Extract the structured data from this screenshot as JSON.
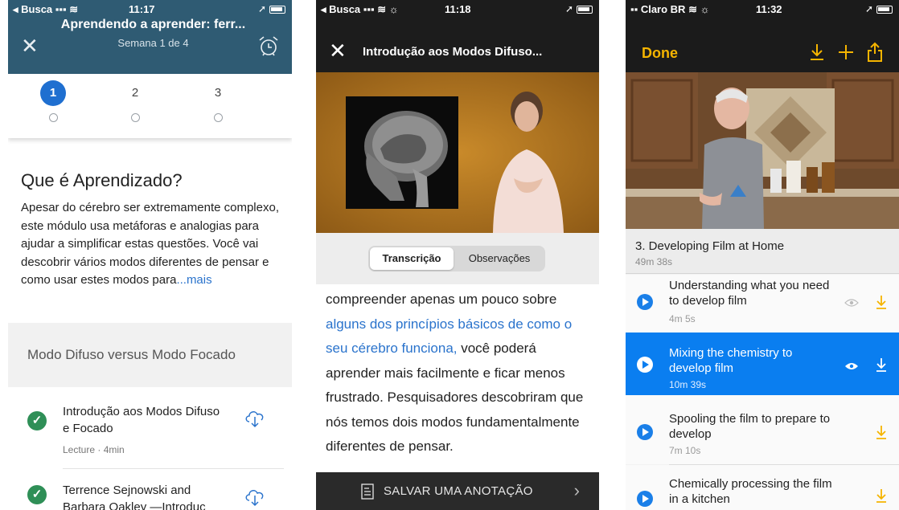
{
  "colors": {
    "coursera_header": "#2f5b73",
    "active_step": "#1f6fd0",
    "check_green": "#2f8f57",
    "link_blue": "#2a73cc",
    "ios_dark": "#1c1c1c",
    "accent_yellow": "#f5b400",
    "selected_row_blue": "#0a7ef0"
  },
  "phone1": {
    "status": {
      "carrier": "◂ Busca",
      "signal": "▪▪▪ ≋",
      "time": "11:17",
      "right": "➚"
    },
    "title": "Aprendendo a aprender: ferr...",
    "subtitle": "Semana 1 de 4",
    "close_icon": "close-icon",
    "alarm_icon": "alarm-clock-icon",
    "steps": [
      {
        "label": "1",
        "active": true
      },
      {
        "label": "2",
        "active": false
      },
      {
        "label": "3",
        "active": false
      }
    ],
    "lesson_title": "Que é Aprendizado?",
    "description": "Apesar do cérebro ser extremamente complexo, este módulo usa metáforas e analogias para ajudar a simplificar estas questões. Você vai descobrir vários modos diferentes de pensar e como usar estes modos para",
    "more_link": "...mais",
    "section_title": "Modo Difuso versus Modo Focado",
    "items": [
      {
        "title": "Introdução aos Modos Difuso e Focado",
        "meta": "Lecture · 4min"
      },
      {
        "title": "Terrence Sejnowski and Barbara Oakley —Introduc",
        "meta": ""
      }
    ]
  },
  "phone2": {
    "status": {
      "carrier": "◂ Busca",
      "signal": "▪▪▪ ≋ ☼",
      "time": "11:18",
      "right": "➚"
    },
    "title": "Introdução aos Modos Difuso...",
    "tabs": [
      "Transcrição",
      "Observações"
    ],
    "transcript_before": "compreender apenas um pouco sobre ",
    "transcript_highlight": "alguns dos princípios básicos de como o seu cérebro funciona,",
    "transcript_after": " você poderá aprender mais facilmente e ficar menos frustrado. Pesquisadores descobriram que nós temos dois modos fundamentalmente diferentes de pensar.",
    "note_label": "SALVAR UMA ANOTAÇÃO",
    "chevron": "›"
  },
  "phone3": {
    "status": {
      "carrier": "▪▪ Claro BR",
      "signal": "≋ ☼",
      "time": "11:32",
      "right": "➚"
    },
    "done_label": "Done",
    "toolbar_icons": [
      "download-icon",
      "plus-icon",
      "share-icon"
    ],
    "lesson_title": "3. Developing Film at Home",
    "lesson_duration": "49m 38s",
    "rows": [
      {
        "title": "Understanding what you need to develop film",
        "duration": "4m 5s",
        "selected": false,
        "watched": true
      },
      {
        "title": "Mixing the chemistry to develop film",
        "duration": "10m 39s",
        "selected": true,
        "watched": true
      },
      {
        "title": "Spooling the film to prepare to develop",
        "duration": "7m 10s",
        "selected": false,
        "watched": false
      },
      {
        "title": "Chemically processing the film in a kitchen",
        "duration": "",
        "selected": false,
        "watched": false
      }
    ]
  }
}
